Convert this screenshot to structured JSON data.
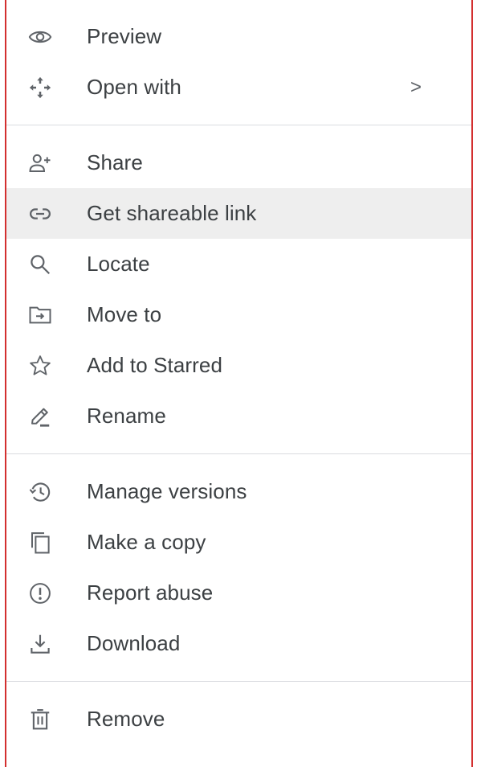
{
  "menu": {
    "group1": [
      {
        "label": "Preview",
        "icon": "eye-icon"
      },
      {
        "label": "Open with",
        "icon": "move-arrows-icon",
        "chevron": ">"
      }
    ],
    "group2": [
      {
        "label": "Share",
        "icon": "person-add-icon"
      },
      {
        "label": "Get shareable link",
        "icon": "link-icon",
        "highlighted": true
      },
      {
        "label": "Locate",
        "icon": "search-icon"
      },
      {
        "label": "Move to",
        "icon": "folder-move-icon"
      },
      {
        "label": "Add to Starred",
        "icon": "star-icon"
      },
      {
        "label": "Rename",
        "icon": "pencil-icon"
      }
    ],
    "group3": [
      {
        "label": "Manage versions",
        "icon": "history-icon"
      },
      {
        "label": "Make a copy",
        "icon": "copy-icon"
      },
      {
        "label": "Report abuse",
        "icon": "report-icon"
      },
      {
        "label": "Download",
        "icon": "download-icon"
      }
    ],
    "group4": [
      {
        "label": "Remove",
        "icon": "trash-icon"
      }
    ]
  },
  "colors": {
    "frame": "#d32f2f",
    "highlight": "#eeeeee",
    "text": "#3c4043",
    "icon": "#5f6368"
  }
}
